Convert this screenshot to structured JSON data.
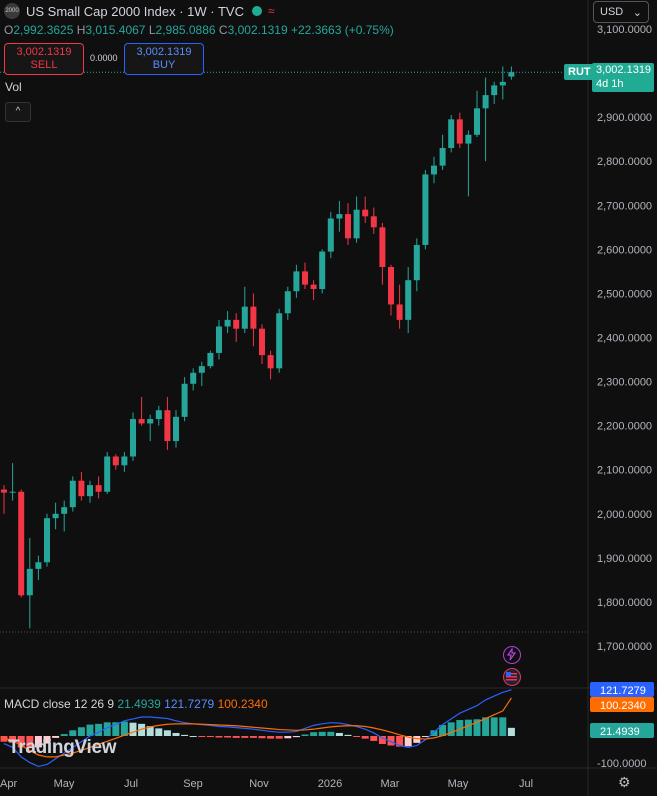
{
  "header": {
    "logo_text": "2000",
    "title": "US Small Cap 2000 Index · 1W · TVC",
    "open_label": "O",
    "open": "2,992.3625",
    "high_label": "H",
    "high": "3,015.4067",
    "low_label": "L",
    "low": "2,985.0886",
    "close_label": "C",
    "close": "3,002.1319",
    "change": "+22.3663 (+0.75%)"
  },
  "trade": {
    "sell_price": "3,002.1319",
    "sell_label": "SELL",
    "spread": "0.0000",
    "buy_price": "3,002.1319",
    "buy_label": "BUY"
  },
  "volume_label": "Vol",
  "collapse_icon": "^",
  "currency": "USD",
  "currency_chevron": "⌄",
  "symbol_badge": "RUT",
  "price_badge": {
    "price": "3,002.1319",
    "countdown": "4d 1h"
  },
  "colors": {
    "up": "#26a69a",
    "down": "#f23645",
    "macd": "#2962ff",
    "signal": "#ff6d00",
    "badge": "#22ab94"
  },
  "macd_legend": {
    "name": "MACD",
    "params": "close 12 26 9",
    "hist": "21.4939",
    "macd": "121.7279",
    "signal": "100.2340"
  },
  "macd_axis": {
    "macd_badge": "121.7279",
    "signal_badge": "100.2340",
    "hist_badge": "21.4939",
    "bottom_tick": "-100.0000"
  },
  "branding": "TradingView",
  "chart_data": {
    "type": "candlestick",
    "title": "US Small Cap 2000 Index · 1W · TVC",
    "price_ticks": [
      "3,100.0000",
      "3,000.0000",
      "2,900.0000",
      "2,800.0000",
      "2,700.0000",
      "2,600.0000",
      "2,500.0000",
      "2,400.0000",
      "2,300.0000",
      "2,200.0000",
      "2,100.0000",
      "2,000.0000",
      "1,900.0000",
      "1,800.0000",
      "1,700.0000"
    ],
    "ylim": [
      1660,
      3105
    ],
    "x_labels": [
      "Apr",
      "May",
      "Jul",
      "Sep",
      "Nov",
      "2026",
      "Mar",
      "May",
      "Jul"
    ],
    "grid": false,
    "series": [
      {
        "name": "RUT",
        "candles": [
          [
            2055,
            2065,
            2000,
            2048
          ],
          [
            2048,
            2115,
            2030,
            2050
          ],
          [
            2050,
            2055,
            1810,
            1815
          ],
          [
            1815,
            1945,
            1740,
            1875
          ],
          [
            1875,
            1905,
            1850,
            1890
          ],
          [
            1890,
            2000,
            1880,
            1990
          ],
          [
            1990,
            2025,
            1965,
            2000
          ],
          [
            2000,
            2030,
            1960,
            2015
          ],
          [
            2015,
            2085,
            2005,
            2075
          ],
          [
            2075,
            2095,
            2030,
            2040
          ],
          [
            2040,
            2075,
            2025,
            2065
          ],
          [
            2065,
            2085,
            2035,
            2050
          ],
          [
            2050,
            2140,
            2045,
            2130
          ],
          [
            2130,
            2135,
            2100,
            2110
          ],
          [
            2110,
            2140,
            2095,
            2130
          ],
          [
            2130,
            2230,
            2120,
            2215
          ],
          [
            2215,
            2265,
            2200,
            2205
          ],
          [
            2205,
            2225,
            2165,
            2215
          ],
          [
            2215,
            2245,
            2200,
            2235
          ],
          [
            2235,
            2265,
            2145,
            2165
          ],
          [
            2165,
            2235,
            2150,
            2220
          ],
          [
            2220,
            2310,
            2210,
            2295
          ],
          [
            2295,
            2330,
            2280,
            2320
          ],
          [
            2320,
            2345,
            2290,
            2335
          ],
          [
            2335,
            2370,
            2330,
            2365
          ],
          [
            2365,
            2440,
            2350,
            2425
          ],
          [
            2425,
            2460,
            2410,
            2440
          ],
          [
            2440,
            2455,
            2390,
            2420
          ],
          [
            2420,
            2515,
            2410,
            2470
          ],
          [
            2470,
            2500,
            2380,
            2420
          ],
          [
            2420,
            2430,
            2340,
            2360
          ],
          [
            2360,
            2370,
            2305,
            2330
          ],
          [
            2330,
            2465,
            2320,
            2455
          ],
          [
            2455,
            2515,
            2440,
            2505
          ],
          [
            2505,
            2565,
            2490,
            2550
          ],
          [
            2550,
            2570,
            2510,
            2520
          ],
          [
            2520,
            2530,
            2485,
            2510
          ],
          [
            2510,
            2600,
            2500,
            2595
          ],
          [
            2595,
            2685,
            2580,
            2670
          ],
          [
            2670,
            2710,
            2640,
            2680
          ],
          [
            2680,
            2705,
            2610,
            2625
          ],
          [
            2625,
            2720,
            2615,
            2690
          ],
          [
            2690,
            2720,
            2660,
            2675
          ],
          [
            2675,
            2695,
            2635,
            2650
          ],
          [
            2650,
            2660,
            2520,
            2560
          ],
          [
            2560,
            2565,
            2450,
            2475
          ],
          [
            2475,
            2520,
            2420,
            2440
          ],
          [
            2440,
            2560,
            2410,
            2530
          ],
          [
            2530,
            2625,
            2505,
            2610
          ],
          [
            2610,
            2780,
            2600,
            2770
          ],
          [
            2770,
            2810,
            2750,
            2790
          ],
          [
            2790,
            2860,
            2780,
            2830
          ],
          [
            2830,
            2905,
            2820,
            2895
          ],
          [
            2895,
            2910,
            2830,
            2840
          ],
          [
            2840,
            2870,
            2720,
            2860
          ],
          [
            2860,
            2960,
            2855,
            2920
          ],
          [
            2920,
            2990,
            2800,
            2950
          ],
          [
            2950,
            2980,
            2930,
            2972
          ],
          [
            2972,
            3015,
            2940,
            2980
          ],
          [
            2992,
            3015,
            2985,
            3002
          ]
        ]
      }
    ],
    "macd": {
      "macd_line": [
        -20,
        -30,
        -55,
        -70,
        -80,
        -75,
        -60,
        -45,
        -30,
        -15,
        0,
        10,
        22,
        30,
        40,
        45,
        50,
        50,
        48,
        46,
        40,
        35,
        32,
        30,
        28,
        25,
        24,
        22,
        20,
        18,
        15,
        12,
        10,
        10,
        12,
        20,
        28,
        32,
        35,
        34,
        30,
        25,
        18,
        8,
        -5,
        -15,
        -25,
        -30,
        -25,
        -10,
        10,
        30,
        45,
        60,
        70,
        80,
        95,
        105,
        115,
        121.7
      ],
      "signal_line": [
        -5,
        -12,
        -25,
        -38,
        -50,
        -55,
        -55,
        -50,
        -45,
        -38,
        -30,
        -22,
        -14,
        -6,
        2,
        10,
        18,
        24,
        28,
        31,
        32,
        32,
        32,
        31,
        30,
        29,
        28,
        27,
        25,
        23,
        21,
        19,
        17,
        16,
        15,
        16,
        18,
        21,
        24,
        26,
        27,
        27,
        25,
        21,
        16,
        10,
        3,
        -3,
        -7,
        -8,
        -5,
        1,
        9,
        18,
        27,
        36,
        46,
        56,
        66,
        100.2
      ],
      "histogram": [
        -15,
        -18,
        -30,
        -32,
        -30,
        -20,
        -5,
        5,
        15,
        23,
        30,
        32,
        36,
        36,
        38,
        35,
        32,
        26,
        20,
        15,
        8,
        3,
        0,
        -1,
        -2,
        -4,
        -4,
        -5,
        -5,
        -5,
        -6,
        -7,
        -7,
        -6,
        -3,
        4,
        10,
        11,
        11,
        8,
        3,
        -2,
        -7,
        -13,
        -21,
        -25,
        -28,
        -27,
        -18,
        -2,
        15,
        29,
        36,
        42,
        43,
        44,
        49,
        49,
        49,
        21.5
      ]
    }
  }
}
